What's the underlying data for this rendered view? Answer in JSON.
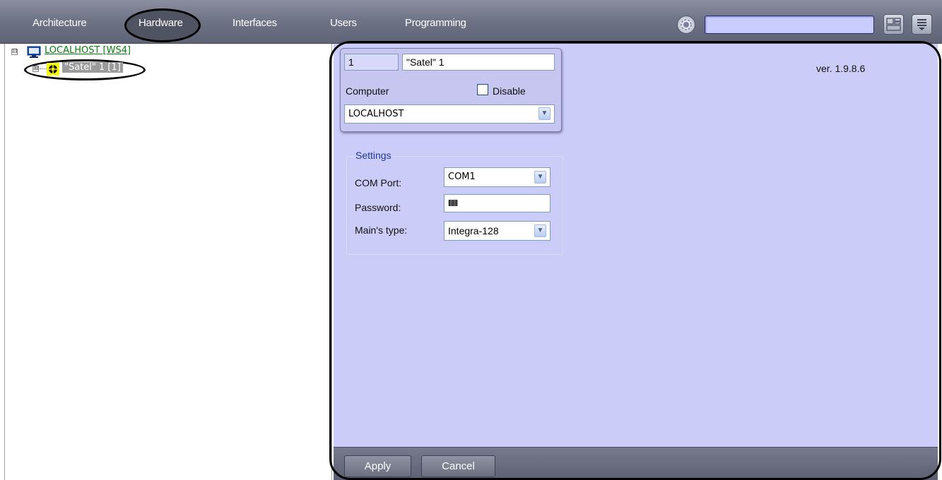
{
  "nav": {
    "tabs": [
      {
        "label": "Architecture"
      },
      {
        "label": "Hardware"
      },
      {
        "label": "Interfaces"
      },
      {
        "label": "Users"
      },
      {
        "label": "Programming"
      }
    ],
    "search_value": "",
    "icons": [
      "settings-circle-icon",
      "layout-grid-icon",
      "menu-list-icon"
    ]
  },
  "tree": {
    "root": {
      "label": "LOCALHOST [WS4]",
      "expander": "⊟",
      "icon": "computer-icon"
    },
    "child": {
      "label": "\"Satel\" 1 [1]",
      "expander": "⊞",
      "icon": "satel-device-icon"
    }
  },
  "panel": {
    "version": "ver. 1.9.8.6",
    "object_id": "1",
    "object_name": "\"Satel\" 1",
    "computer_label": "Computer",
    "disable_label": "Disable",
    "disable_checked": false,
    "computer_value": "LOCALHOST",
    "settings": {
      "title": "Settings",
      "com_port_label": "COM Port:",
      "com_port_value": "COM1",
      "password_label": "Password:",
      "password_value": "IIIII",
      "mains_type_label": "Main's type:",
      "mains_type_value": "Integra-128"
    },
    "apply_label": "Apply",
    "cancel_label": "Cancel"
  },
  "colors": {
    "panel_bg": "#ccccf9",
    "topbar": "#6f7386",
    "tree_host": "#0b7a12",
    "selected_bg": "#9b9b9b"
  }
}
